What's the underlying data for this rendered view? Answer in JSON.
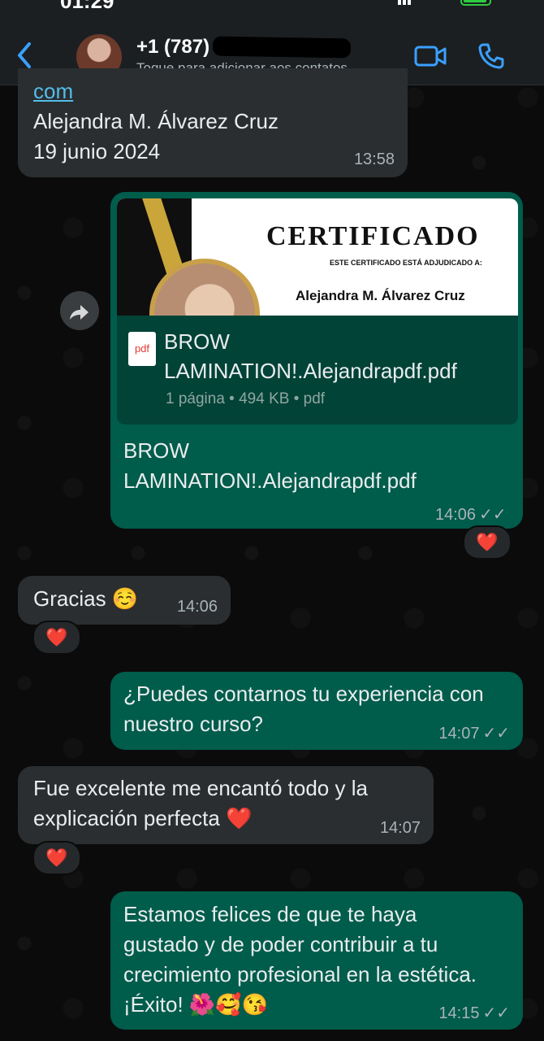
{
  "status_bar": {
    "time": "01:29"
  },
  "header": {
    "back_icon": "chevron-left-icon",
    "contact_name": "+1 (787)",
    "contact_subtitle": "Toque para adicionar aos contatos",
    "video_icon": "video-call-icon",
    "call_icon": "phone-icon"
  },
  "messages": [
    {
      "id": "m1",
      "direction": "in",
      "lines": [
        "com",
        "Alejandra M. Álvarez Cruz",
        "19 junio 2024"
      ],
      "time": "13:58"
    },
    {
      "id": "m2",
      "direction": "out",
      "certificate": {
        "title": "CERTIFICADO",
        "subtitle": "ESTE CERTIFICADO ESTÁ ADJUDICADO A:",
        "name": "Alejandra M. Álvarez Cruz"
      },
      "file": {
        "icon_label": "pdf",
        "name": "BROW LAMINATION!.Alejandrapdf.pdf",
        "meta": "1 página • 494 KB • pdf"
      },
      "caption": "BROW LAMINATION!.Alejandrapdf.pdf",
      "time": "14:06",
      "status": "read",
      "reaction": "❤️"
    },
    {
      "id": "m3",
      "direction": "in",
      "text": "Gracias ☺️",
      "time": "14:06",
      "reaction": "❤️"
    },
    {
      "id": "m4",
      "direction": "out",
      "text": "¿Puedes contarnos tu experiencia con nuestro curso?",
      "time": "14:07",
      "status": "read"
    },
    {
      "id": "m5",
      "direction": "in",
      "text": "Fue excelente me encantó todo y la explicación perfecta ❤️",
      "time": "14:07",
      "reaction": "❤️"
    },
    {
      "id": "m6",
      "direction": "out",
      "text": "Estamos felices de que te haya gustado y de poder contribuir a tu crecimiento profesional en la estética. ¡Éxito! 🌺🥰😘",
      "time": "14:15",
      "status": "read"
    }
  ],
  "colors": {
    "incoming_bubble": "#2a2e30",
    "outgoing_bubble": "#005c4b",
    "accent": "#3aa0ff",
    "link": "#53bdeb"
  }
}
